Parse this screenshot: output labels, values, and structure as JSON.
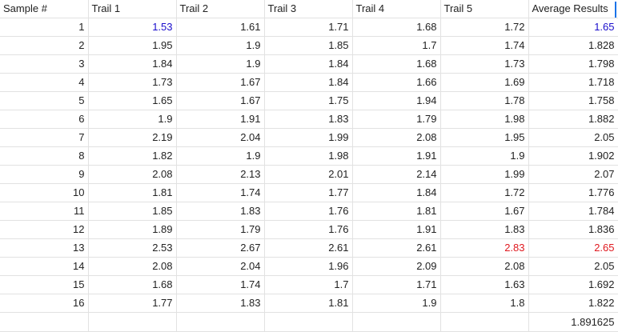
{
  "sheet": {
    "headers": [
      "Sample #",
      "Trail 1",
      "Trail 2",
      "Trail 3",
      "Trail 4",
      "Trail 5",
      "Average Results"
    ],
    "rows": [
      [
        "1",
        "1.53",
        "1.61",
        "1.71",
        "1.68",
        "1.72",
        "1.65"
      ],
      [
        "2",
        "1.95",
        "1.9",
        "1.85",
        "1.7",
        "1.74",
        "1.828"
      ],
      [
        "3",
        "1.84",
        "1.9",
        "1.84",
        "1.68",
        "1.73",
        "1.798"
      ],
      [
        "4",
        "1.73",
        "1.67",
        "1.84",
        "1.66",
        "1.69",
        "1.718"
      ],
      [
        "5",
        "1.65",
        "1.67",
        "1.75",
        "1.94",
        "1.78",
        "1.758"
      ],
      [
        "6",
        "1.9",
        "1.91",
        "1.83",
        "1.79",
        "1.98",
        "1.882"
      ],
      [
        "7",
        "2.19",
        "2.04",
        "1.99",
        "2.08",
        "1.95",
        "2.05"
      ],
      [
        "8",
        "1.82",
        "1.9",
        "1.98",
        "1.91",
        "1.9",
        "1.902"
      ],
      [
        "9",
        "2.08",
        "2.13",
        "2.01",
        "2.14",
        "1.99",
        "2.07"
      ],
      [
        "10",
        "1.81",
        "1.74",
        "1.77",
        "1.84",
        "1.72",
        "1.776"
      ],
      [
        "11",
        "1.85",
        "1.83",
        "1.76",
        "1.81",
        "1.67",
        "1.784"
      ],
      [
        "12",
        "1.89",
        "1.79",
        "1.76",
        "1.91",
        "1.83",
        "1.836"
      ],
      [
        "13",
        "2.53",
        "2.67",
        "2.61",
        "2.61",
        "2.83",
        "2.65"
      ],
      [
        "14",
        "2.08",
        "2.04",
        "1.96",
        "2.09",
        "2.08",
        "2.05"
      ],
      [
        "15",
        "1.68",
        "1.74",
        "1.7",
        "1.71",
        "1.63",
        "1.692"
      ],
      [
        "16",
        "1.77",
        "1.83",
        "1.81",
        "1.9",
        "1.8",
        "1.822"
      ]
    ],
    "overall_average": "1.891625",
    "highlight_colors": {
      "blue": "#1a0dcc",
      "red": "#e0191f",
      "selection": "#1a73e8"
    }
  }
}
